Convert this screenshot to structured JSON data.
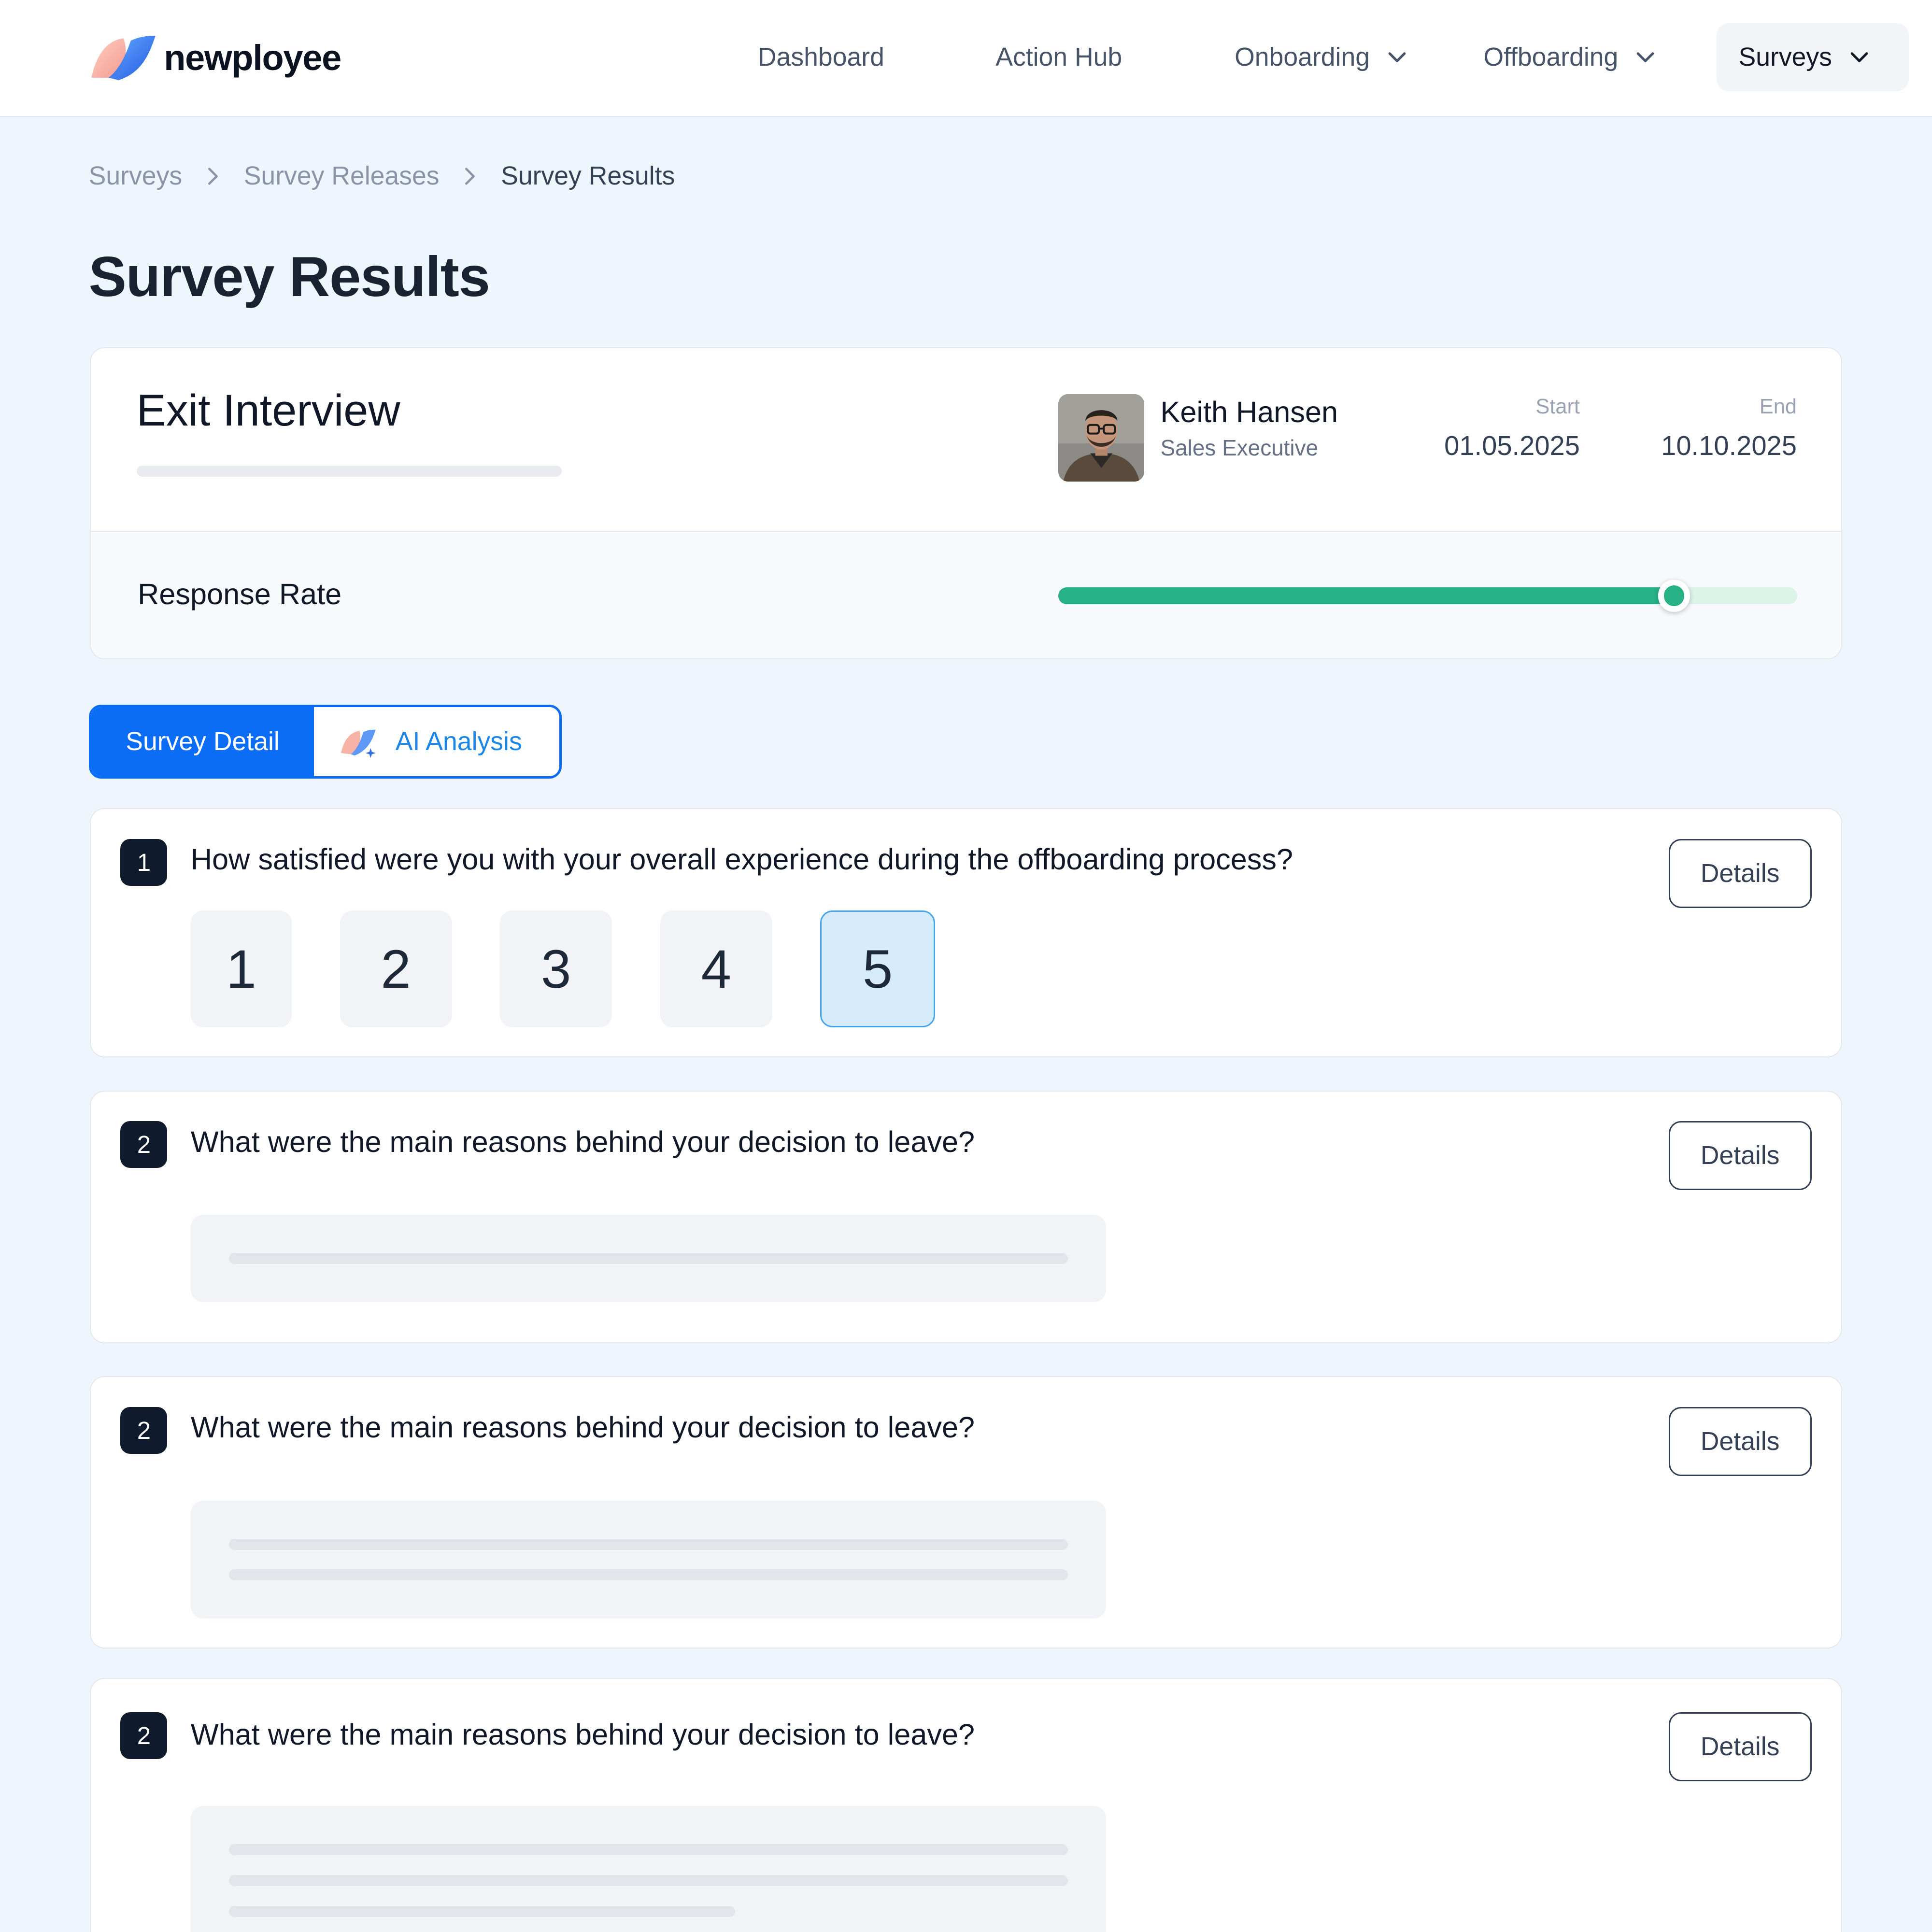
{
  "brand": {
    "name": "newployee"
  },
  "nav": {
    "dashboard": "Dashboard",
    "action_hub": "Action Hub",
    "onboarding": "Onboarding",
    "offboarding": "Offboarding",
    "surveys": "Surveys"
  },
  "breadcrumb": [
    "Surveys",
    "Survey Releases",
    "Survey Results"
  ],
  "page_title": "Survey Results",
  "survey": {
    "name": "Exit Interview",
    "person": {
      "name": "Keith Hansen",
      "role": "Sales Executive"
    },
    "start_label": "Start",
    "start_date": "01.05.2025",
    "end_label": "End",
    "end_date": "10.10.2025",
    "response_rate_label": "Response Rate",
    "response_rate_fraction": 0.833
  },
  "tabs": {
    "detail": "Survey Detail",
    "ai": "AI Analysis"
  },
  "questions": [
    {
      "number": "1",
      "text": "How satisfied were you with your overall experience during the offboarding process?",
      "scale": [
        "1",
        "2",
        "3",
        "4",
        "5"
      ],
      "selected": "5",
      "details_label": "Details"
    },
    {
      "number": "2",
      "text": "What were the main reasons behind your decision to leave?",
      "details_label": "Details"
    },
    {
      "number": "2",
      "text": "What were the main reasons behind your decision to leave?",
      "details_label": "Details"
    },
    {
      "number": "2",
      "text": "What were the main reasons behind your decision to leave?",
      "details_label": "Details"
    }
  ],
  "colors": {
    "primary": "#0b6cf5",
    "success": "#27b184",
    "page_bg": "#eef5fd",
    "selected_scale_bg": "#d6ebfb"
  },
  "icons": [
    "newployee-logo-icon",
    "chevron-down-icon",
    "chevron-right-icon",
    "ai-sparkle-icon"
  ]
}
